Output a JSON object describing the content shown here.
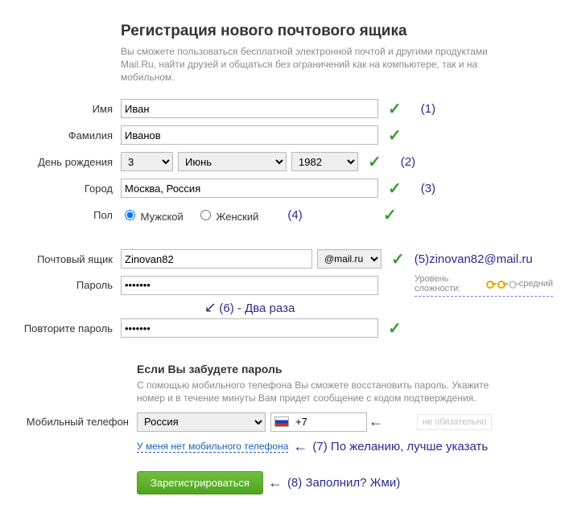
{
  "heading": "Регистрация нового почтового ящика",
  "subtitle": "Вы сможете пользоваться бесплатной электронной почтой и другими продуктами Mail.Ru, найти друзей и общаться без ограничений как на компьютере, так и на мобильном.",
  "labels": {
    "firstname": "Имя",
    "lastname": "Фамилия",
    "birthday": "День рождения",
    "city": "Город",
    "gender": "Пол",
    "mailbox": "Почтовый ящик",
    "password": "Пароль",
    "password2": "Повторите пароль",
    "mobile": "Мобильный телефон"
  },
  "values": {
    "firstname": "Иван",
    "lastname": "Иванов",
    "day": "3",
    "month": "Июнь",
    "year": "1982",
    "city": "Москва, Россия",
    "gender_male": "Мужской",
    "gender_female": "Женский",
    "mailbox_user": "Zinovan82",
    "mailbox_domain": "@mail.ru",
    "password": "•••••••",
    "password2": "•••••••",
    "mobile_country": "Россия",
    "mobile_code": "+7"
  },
  "recovery": {
    "heading": "Если Вы забудете пароль",
    "text": "С помощью мобильного телефона Вы сможете восстановить пароль. Укажите номер и в течение минуты Вам придет сообщение с кодом подтверждения.",
    "optional": "не обязательно",
    "no_phone_link": "У меня нет мобильного телефона"
  },
  "strength": {
    "label": "Уровень сложности:",
    "value": "средний"
  },
  "submit": "Зарегистрироваться",
  "annotations": {
    "a1": "(1)",
    "a2": "(2)",
    "a3": "(3)",
    "a4": "(4)",
    "a5": "(5)zinovan82@mail.ru",
    "a6": "(6) - Два раза",
    "a7": "(7) По желанию, лучше указать",
    "a8": "(8) Заполнил? Жми)"
  }
}
